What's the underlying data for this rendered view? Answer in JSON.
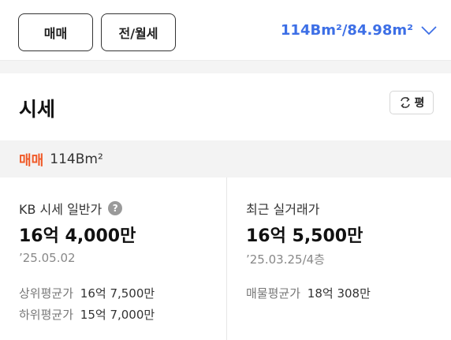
{
  "tabs": {
    "sale": "매매",
    "rent": "전/월세"
  },
  "area_selector": {
    "label": "114Bm²/84.98m²",
    "icon": "chevron-down-icon",
    "color": "#3d6fe6"
  },
  "section": {
    "title": "시세",
    "unit_toggle_label": "평",
    "unit_toggle_icon": "swap-icon"
  },
  "subhead": {
    "deal_type": "매매",
    "area": "114Bm²",
    "deal_color": "#f05a28"
  },
  "kb": {
    "label": "KB 시세 일반가",
    "help_icon": "?",
    "price": "16억 4,000만",
    "date": "’25.05.02",
    "upper_label": "상위평균가",
    "upper_value": "16억 7,500만",
    "lower_label": "하위평균가",
    "lower_value": "15억 7,000만"
  },
  "real": {
    "label": "최근 실거래가",
    "price": "16억 5,500만",
    "date": "’25.03.25/4층",
    "listing_label": "매물평균가",
    "listing_value": "18억 308만"
  }
}
